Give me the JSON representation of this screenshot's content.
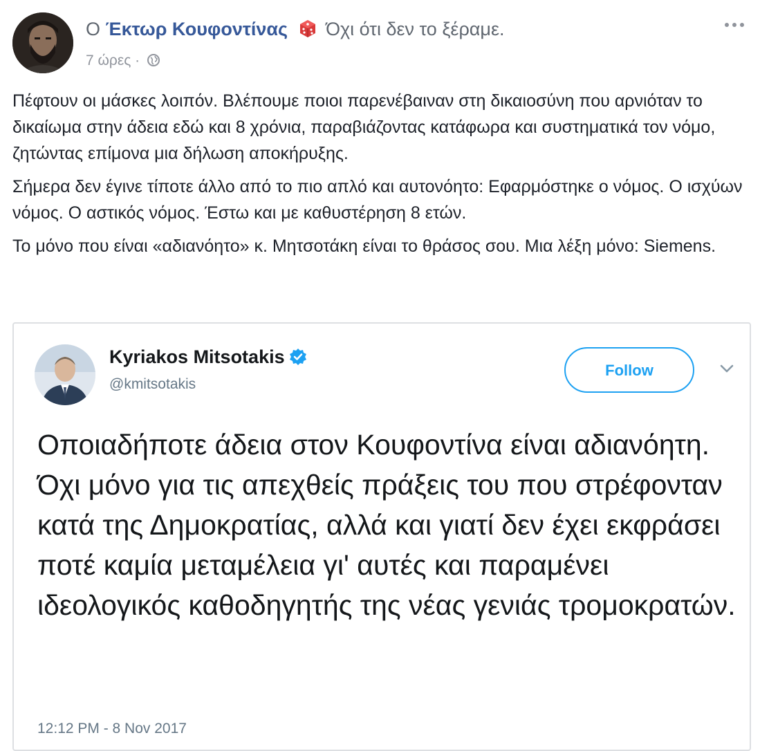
{
  "post": {
    "prefix": "Ο",
    "author": "Έκτωρ Κουφοντίνας",
    "feeling_icon": "red-dice-icon",
    "feeling_text": "Όχι ότι δεν το ξέραμε.",
    "time": "7 ώρες",
    "separator": " · ",
    "privacy_icon": "globe-icon",
    "more_icon": "more-dots-icon",
    "paragraphs": [
      "Πέφτουν οι μάσκες λοιπόν. Βλέπουμε ποιοι παρενέβαιναν στη δικαιοσύνη που αρνιόταν το δικαίωμα στην άδεια εδώ και 8 χρόνια, παραβιάζοντας κατάφωρα και συστηματικά τον νόμο, ζητώντας επίμονα μια δήλωση αποκήρυξης.",
      "Σήμερα δεν έγινε τίποτε άλλο από το πιο απλό και αυτονόητο: Εφαρμόστηκε ο νόμος. Ο ισχύων νόμος. Ο αστικός νόμος. Έστω και με καθυστέρηση 8 ετών.",
      "Το μόνο που είναι «αδιανόητο» κ. Μητσοτάκη είναι το θράσος σου. Μια λέξη μόνο: Siemens."
    ]
  },
  "tweet": {
    "name": "Kyriakos Mitsotakis",
    "verified_icon": "verified-badge-icon",
    "handle": "@kmitsotakis",
    "follow_label": "Follow",
    "chevron_icon": "chevron-down-icon",
    "text": "Οποιαδήποτε άδεια στον Κουφοντίνα είναι αδιανόητη. Όχι μόνο για τις απεχθείς πράξεις του που στρέφονταν κατά της Δημοκρατίας, αλλά και γιατί δεν έχει εκφράσει ποτέ καμία μεταμέλεια γι' αυτές και παραμένει ιδεολογικός καθοδηγητής της νέας γενιάς τρομοκρατών.",
    "timestamp": "12:12 PM - 8 Nov 2017"
  },
  "colors": {
    "facebook_link": "#365899",
    "text": "#1d2129",
    "meta": "#90949c",
    "twitter_blue": "#1da1f2",
    "twitter_gray": "#657786",
    "dice_red": "#d93a3a"
  }
}
